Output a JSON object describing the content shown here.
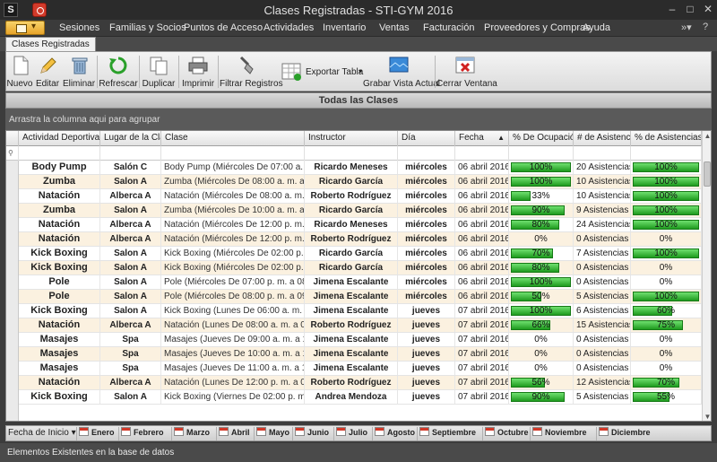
{
  "window": {
    "title": "Clases Registradas - STI-GYM 2016",
    "app_icon": "sti-logo-icon"
  },
  "menu": [
    "Sesiones",
    "Familias y Socios",
    "Puntos de Acceso",
    "Actividades",
    "Inventario",
    "Ventas",
    "Facturación",
    "Proveedores y Compras",
    "Ayuda"
  ],
  "doc_tab": "Clases Registradas",
  "toolbar": {
    "nuevo": "Nuevo",
    "editar": "Editar",
    "eliminar": "Eliminar",
    "refrescar": "Refrescar",
    "duplicar": "Duplicar",
    "imprimir": "Imprimir",
    "filtrar": "Filtrar Registros",
    "exportar": "Exportar Tabla",
    "grabar": "Grabar Vista Actual",
    "cerrar": "Cerrar Ventana"
  },
  "grid": {
    "title": "Todas las Clases",
    "group_hint": "Arrastra la columna aqui para agrupar",
    "columns": [
      "Actividad Deportiva",
      "Lugar de la Clase",
      "Clase",
      "Instructor",
      "Día",
      "Fecha",
      "% De Ocupación",
      "# de Asistencias",
      "% de Asistencias"
    ],
    "sort_column": "Fecha",
    "rows": [
      {
        "act": "Body Pump",
        "lugar": "Salón C",
        "clase": "Body Pump (Miércoles De 07:00 a. m. a 08:00 a. m.)",
        "instr": "Ricardo  Meneses",
        "dia": "miércoles",
        "fecha": "06 abril 2016",
        "ocup": 100,
        "asist": "20 Asistencias",
        "pasist": 100
      },
      {
        "act": "Zumba",
        "lugar": "Salon A",
        "clase": "Zumba (Miércoles De 08:00 a. m. a 09:00 a. m.)",
        "instr": "Ricardo  García",
        "dia": "miércoles",
        "fecha": "06 abril 2016",
        "ocup": 100,
        "asist": "10 Asistencias",
        "pasist": 100
      },
      {
        "act": "Natación",
        "lugar": "Alberca A",
        "clase": "Natación (Miércoles De 08:00 a. m. a 09:00 a. m.)",
        "instr": "Roberto Rodríguez",
        "dia": "miércoles",
        "fecha": "06 abril 2016",
        "ocup": 33,
        "asist": "10 Asistencias",
        "pasist": 100
      },
      {
        "act": "Zumba",
        "lugar": "Salon A",
        "clase": "Zumba (Miércoles De 10:00 a. m. a 11:00 a. m.)",
        "instr": "Ricardo  García",
        "dia": "miércoles",
        "fecha": "06 abril 2016",
        "ocup": 90,
        "asist": "9 Asistencias",
        "pasist": 100
      },
      {
        "act": "Natación",
        "lugar": "Alberca A",
        "clase": "Natación (Miércoles De 12:00 p. m. a 01:00 p. m.)",
        "instr": "Ricardo  Meneses",
        "dia": "miércoles",
        "fecha": "06 abril 2016",
        "ocup": 80,
        "asist": "24 Asistencias",
        "pasist": 100
      },
      {
        "act": "Natación",
        "lugar": "Alberca A",
        "clase": "Natación (Miércoles De 12:00 p. m. a 01:00 p. m.)",
        "instr": "Roberto Rodríguez",
        "dia": "miércoles",
        "fecha": "06 abril 2016",
        "ocup": 0,
        "asist": "0 Asistencias",
        "pasist": 0
      },
      {
        "act": "Kick Boxing",
        "lugar": "Salon A",
        "clase": "Kick Boxing (Miércoles De 02:00 p. m. a 03:00 p. m.)",
        "instr": "Ricardo  García",
        "dia": "miércoles",
        "fecha": "06 abril 2016",
        "ocup": 70,
        "asist": "7 Asistencias",
        "pasist": 100
      },
      {
        "act": "Kick Boxing",
        "lugar": "Salon A",
        "clase": "Kick Boxing (Miércoles De 02:00 p. m. a 03:00 p. m.)",
        "instr": "Ricardo  García",
        "dia": "miércoles",
        "fecha": "06 abril 2016",
        "ocup": 80,
        "asist": "0 Asistencias",
        "pasist": 0
      },
      {
        "act": "Pole",
        "lugar": "Salon A",
        "clase": "Pole (Miércoles De 07:00 p. m. a 08:00 p. m.)",
        "instr": "Jimena Escalante",
        "dia": "miércoles",
        "fecha": "06 abril 2016",
        "ocup": 100,
        "asist": "0 Asistencias",
        "pasist": 0
      },
      {
        "act": "Pole",
        "lugar": "Salon A",
        "clase": "Pole (Miércoles De 08:00 p. m. a 09:00 p. m.)",
        "instr": "Jimena Escalante",
        "dia": "miércoles",
        "fecha": "06 abril 2016",
        "ocup": 50,
        "asist": "5 Asistencias",
        "pasist": 100
      },
      {
        "act": "Kick Boxing",
        "lugar": "Salon A",
        "clase": "Kick Boxing (Lunes De 06:00 a. m. a 07:00 a. m.)",
        "instr": "Jimena Escalante",
        "dia": "jueves",
        "fecha": "07 abril 2016",
        "ocup": 100,
        "asist": "6 Asistencias",
        "pasist": 60
      },
      {
        "act": "Natación",
        "lugar": "Alberca A",
        "clase": "Natación (Lunes De 08:00 a. m. a 09:00 a. m.)",
        "instr": "Roberto Rodríguez",
        "dia": "jueves",
        "fecha": "07 abril 2016",
        "ocup": 66,
        "asist": "15 Asistencias",
        "pasist": 75
      },
      {
        "act": "Masajes",
        "lugar": "Spa",
        "clase": "Masajes (Jueves De 09:00 a. m. a 10:00 a. m.)",
        "instr": "Jimena Escalante",
        "dia": "jueves",
        "fecha": "07 abril 2016",
        "ocup": 0,
        "asist": "0 Asistencias",
        "pasist": 0
      },
      {
        "act": "Masajes",
        "lugar": "Spa",
        "clase": "Masajes (Jueves De 10:00 a. m. a 11:00 a. m.)",
        "instr": "Jimena Escalante",
        "dia": "jueves",
        "fecha": "07 abril 2016",
        "ocup": 0,
        "asist": "0 Asistencias",
        "pasist": 0
      },
      {
        "act": "Masajes",
        "lugar": "Spa",
        "clase": "Masajes (Jueves De 11:00 a. m. a 12:00 p. m.)",
        "instr": "Jimena Escalante",
        "dia": "jueves",
        "fecha": "07 abril 2016",
        "ocup": 0,
        "asist": "0 Asistencias",
        "pasist": 0
      },
      {
        "act": "Natación",
        "lugar": "Alberca A",
        "clase": "Natación (Lunes De 12:00 p. m. a 01:00 p. m.)",
        "instr": "Roberto Rodríguez",
        "dia": "jueves",
        "fecha": "07 abril 2016",
        "ocup": 56,
        "asist": "12 Asistencias",
        "pasist": 70
      },
      {
        "act": "Kick Boxing",
        "lugar": "Salon A",
        "clase": "Kick Boxing (Viernes De 02:00 p. m. a 03:00 p. m.)",
        "instr": "Andrea Mendoza",
        "dia": "jueves",
        "fecha": "07 abril 2016",
        "ocup": 90,
        "asist": "5 Asistencias",
        "pasist": 55
      }
    ]
  },
  "month_bar": {
    "label": "Fecha de Inicio ▾",
    "months": [
      "Enero",
      "Febrero",
      "Marzo",
      "Abril",
      "Mayo",
      "Junio",
      "Julio",
      "Agosto",
      "Septiembre",
      "Octubre",
      "Noviembre",
      "Diciembre"
    ]
  },
  "status": "Elementos Existentes en la base de datos",
  "colors": {
    "bar": "#2fb52f",
    "row_alt": "#fbf1e0",
    "frame": "#3c3c3c"
  }
}
